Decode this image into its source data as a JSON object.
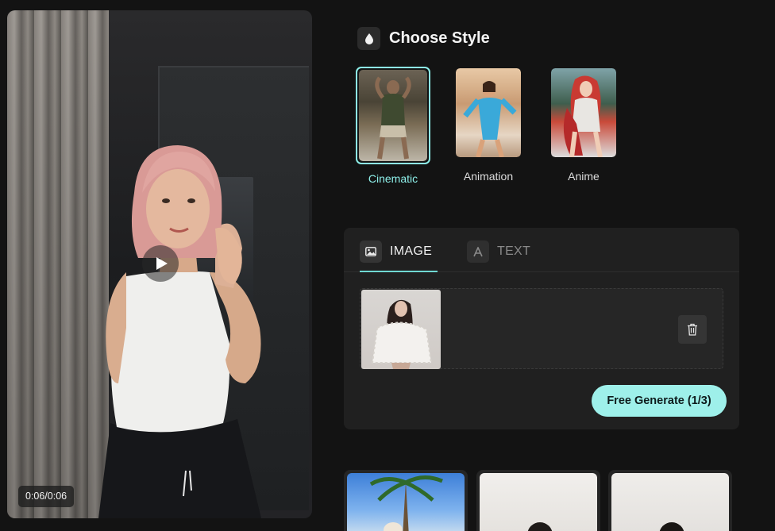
{
  "video": {
    "time": "0:06/0:06",
    "play_icon": "play-icon"
  },
  "style_section": {
    "title": "Choose Style",
    "icon": "drop-icon",
    "accent_color": "#8ef0ea",
    "options": [
      {
        "label": "Cinematic",
        "selected": true
      },
      {
        "label": "Animation",
        "selected": false
      },
      {
        "label": "Anime",
        "selected": false
      }
    ]
  },
  "input_panel": {
    "tabs": [
      {
        "label": "IMAGE",
        "icon": "image-icon",
        "active": true
      },
      {
        "label": "TEXT",
        "icon": "text-icon",
        "active": false
      }
    ],
    "delete_icon": "trash-icon",
    "generate_label": "Free Generate (1/3)",
    "generate_color": "#9ef0ea"
  },
  "gallery": {
    "items": [
      {
        "kind": "sample-video"
      },
      {
        "kind": "sample-video"
      },
      {
        "kind": "sample-video"
      }
    ]
  }
}
